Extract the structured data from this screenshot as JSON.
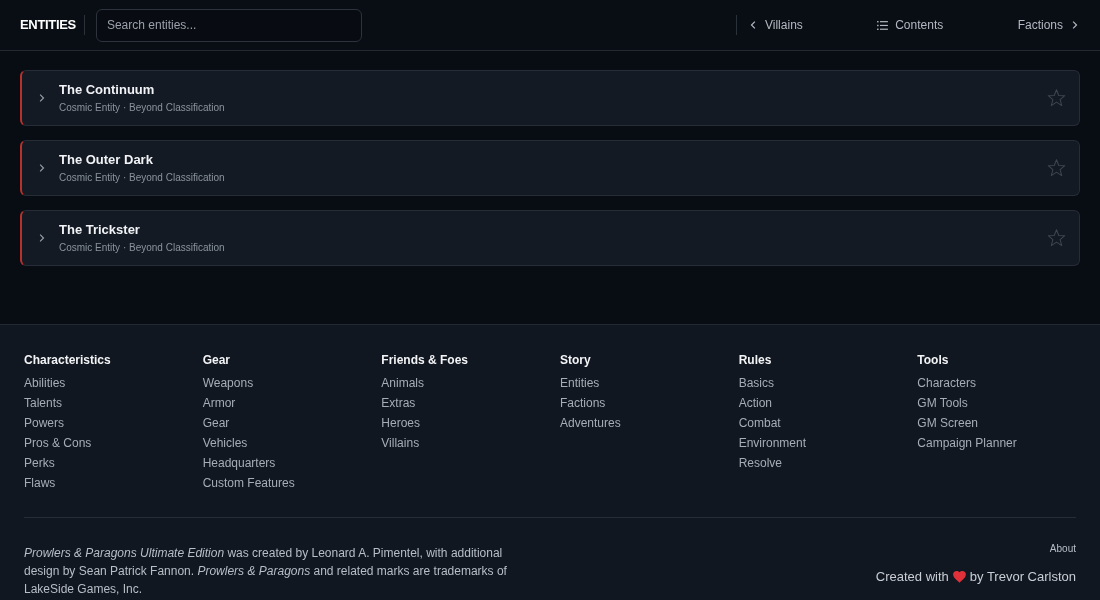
{
  "header": {
    "title": "ENTITIES",
    "search": {
      "placeholder": "Search entities..."
    },
    "nav": [
      {
        "kind": "prev",
        "label": "Villains"
      },
      {
        "kind": "contents",
        "label": "Contents"
      },
      {
        "kind": "next",
        "label": "Factions"
      }
    ]
  },
  "entities": [
    {
      "name": "The Continuum",
      "subtitle": "Cosmic Entity · Beyond Classification",
      "expanded": false,
      "favorite": false
    },
    {
      "name": "The Outer Dark",
      "subtitle": "Cosmic Entity · Beyond Classification",
      "expanded": false,
      "favorite": false
    },
    {
      "name": "The Trickster",
      "subtitle": "Cosmic Entity · Beyond Classification",
      "expanded": false,
      "favorite": false
    }
  ],
  "footer": {
    "columns": [
      {
        "heading": "Characteristics",
        "links": [
          "Abilities",
          "Talents",
          "Powers",
          "Pros & Cons",
          "Perks",
          "Flaws"
        ]
      },
      {
        "heading": "Gear",
        "links": [
          "Weapons",
          "Armor",
          "Gear",
          "Vehicles",
          "Headquarters",
          "Custom Features"
        ]
      },
      {
        "heading": "Friends & Foes",
        "links": [
          "Animals",
          "Extras",
          "Heroes",
          "Villains"
        ]
      },
      {
        "heading": "Story",
        "links": [
          "Entities",
          "Factions",
          "Adventures"
        ]
      },
      {
        "heading": "Rules",
        "links": [
          "Basics",
          "Action",
          "Combat",
          "Environment",
          "Resolve"
        ]
      },
      {
        "heading": "Tools",
        "links": [
          "Characters",
          "GM Tools",
          "GM Screen",
          "Campaign Planner"
        ]
      }
    ],
    "credits": "*Prowlers & Paragons Ultimate Edition* was created by Leonard A. Pimentel, with additional design by Sean Patrick Fannon. *Prowlers & Paragons* and related marks are trademarks of LakeSide Games, Inc.",
    "about": "About",
    "created_by": {
      "before": "Created with",
      "after": "by Trevor Carlston"
    }
  }
}
